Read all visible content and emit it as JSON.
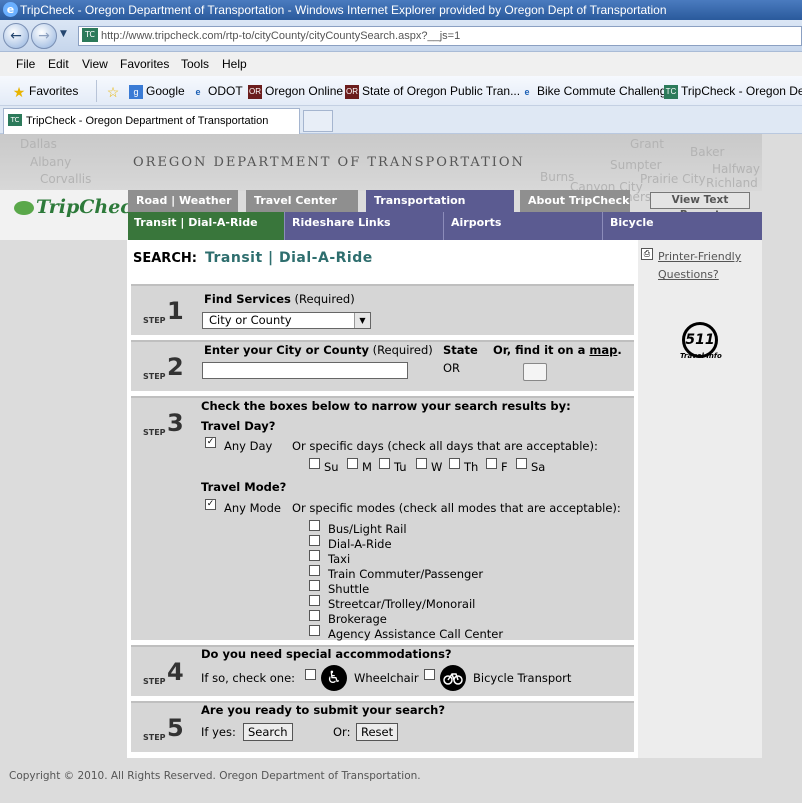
{
  "window": {
    "title": "TripCheck - Oregon Department of Transportation - Windows Internet Explorer provided by Oregon Dept of Transportation"
  },
  "address": {
    "url": "http://www.tripcheck.com/rtp-to/cityCounty/cityCountySearch.aspx?__js=1"
  },
  "menubar": [
    "File",
    "Edit",
    "View",
    "Favorites",
    "Tools",
    "Help"
  ],
  "favorites": {
    "label": "Favorites",
    "items": [
      "Google",
      "ODOT",
      "Oregon Online",
      "State of Oregon Public Tran...",
      "Bike Commute Challenge",
      "TripCheck - Oregon Depa"
    ]
  },
  "tab": {
    "title": "TripCheck - Oregon Department of Transportation"
  },
  "header": {
    "agency": "OREGON DEPARTMENT OF TRANSPORTATION",
    "logo": "TripCheck",
    "map_words": [
      "Dallas",
      "Albany",
      "Corvallis",
      "Grant",
      "Baker",
      "Sumpter",
      "Canyon City",
      "Prairie City",
      "Burns",
      "Brothers",
      "Halfway",
      "Richland"
    ]
  },
  "toptabs": [
    "Road | Weather",
    "Travel Center",
    "Transportation Options",
    "About TripCheck"
  ],
  "text_report": "View Text Report",
  "subnav": [
    "Transit | Dial-A-Ride",
    "Rideshare Links",
    "Airports",
    "Bicycle"
  ],
  "search": {
    "prefix": "SEARCH:",
    "title": "Transit | Dial-A-Ride"
  },
  "sidebar": {
    "printer": "Printer-Friendly",
    "questions": "Questions?",
    "travel_info": "Travel Info",
    "number": "511"
  },
  "step_label": "STEP",
  "step1": {
    "num": "1",
    "title": "Find Services",
    "req": "(Required)",
    "select": "City or County"
  },
  "step2": {
    "num": "2",
    "title": "Enter your City or County",
    "req": "(Required)",
    "state_label": "State",
    "state_value": "OR",
    "map_prefix": "Or, find it on a",
    "map_link": "map",
    "map_suffix": "."
  },
  "step3": {
    "num": "3",
    "heading": "Check the boxes below to narrow your search results by:",
    "day_title": "Travel Day?",
    "any_day": "Any Day",
    "days_hint": "Or specific days (check all days that are acceptable):",
    "days": [
      "Su",
      "M",
      "Tu",
      "W",
      "Th",
      "F",
      "Sa"
    ],
    "mode_title": "Travel Mode?",
    "any_mode": "Any Mode",
    "modes_hint": "Or specific modes (check all modes that are acceptable):",
    "modes": [
      "Bus/Light Rail",
      "Dial-A-Ride",
      "Taxi",
      "Train Commuter/Passenger",
      "Shuttle",
      "Streetcar/Trolley/Monorail",
      "Brokerage",
      "Agency Assistance Call Center"
    ]
  },
  "step4": {
    "num": "4",
    "question": "Do you need special accommodations?",
    "prompt": "If so, check one:",
    "wheelchair": "Wheelchair",
    "bicycle": "Bicycle Transport"
  },
  "step5": {
    "num": "5",
    "question": "Are you ready to submit your search?",
    "if_yes": "If yes:",
    "search_btn": "Search",
    "or": "Or:",
    "reset_btn": "Reset"
  },
  "footer": "Copyright © 2010. All Rights Reserved. Oregon Department of Transportation."
}
